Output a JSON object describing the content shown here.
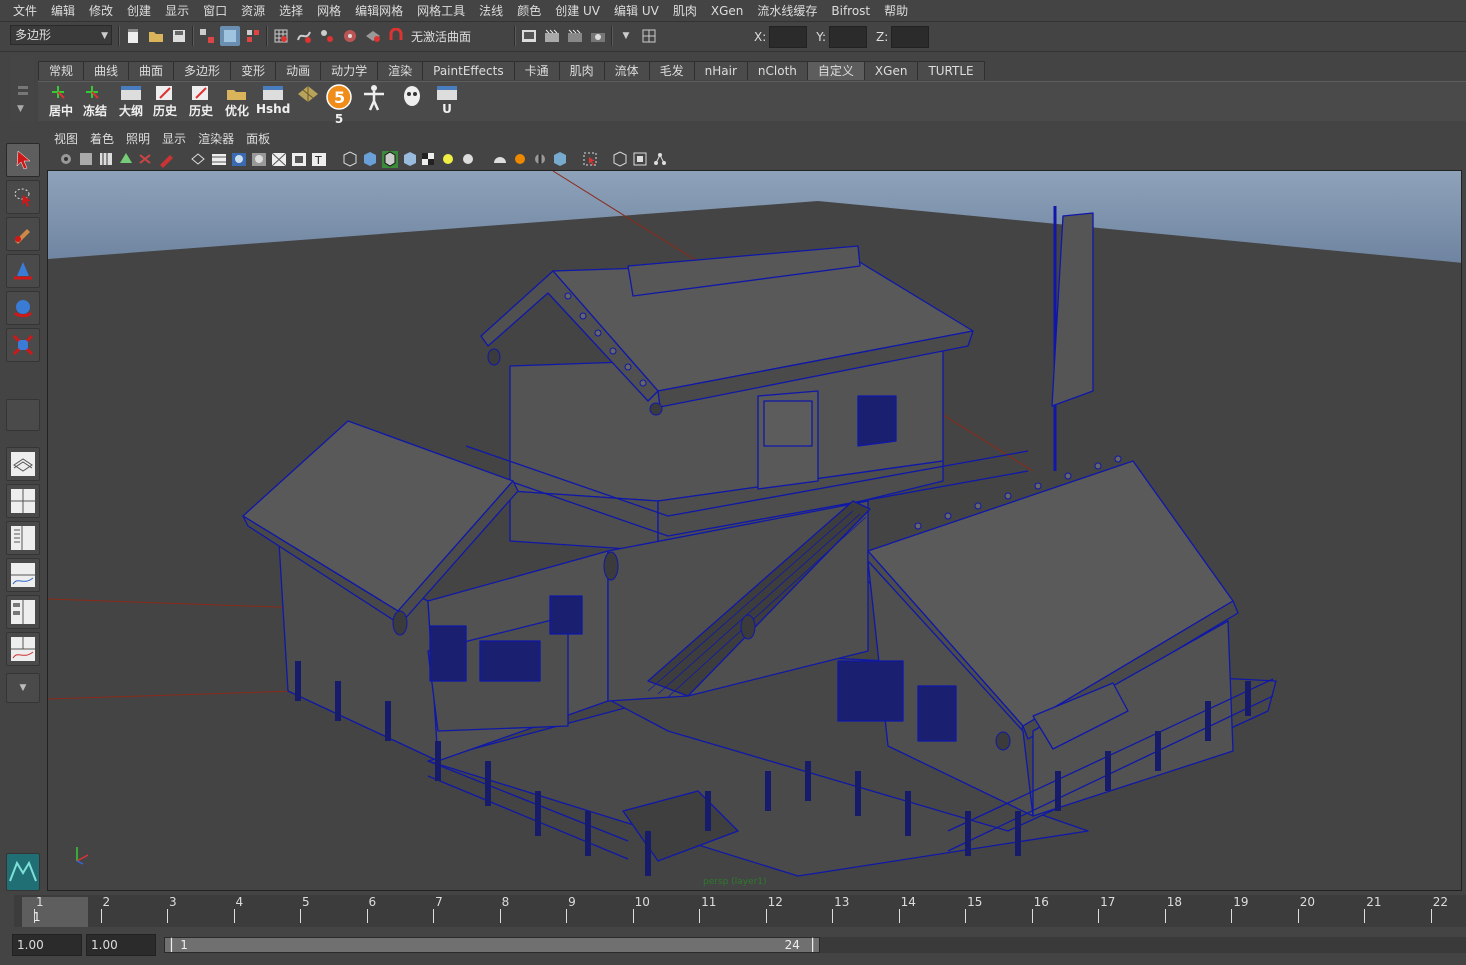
{
  "menubar": [
    "文件",
    "编辑",
    "修改",
    "创建",
    "显示",
    "窗口",
    "资源",
    "选择",
    "网格",
    "编辑网格",
    "网格工具",
    "法线",
    "颜色",
    "创建 UV",
    "编辑 UV",
    "肌肉",
    "XGen",
    "流水线缓存",
    "Bifrost",
    "帮助"
  ],
  "statusline": {
    "mode": "多边形",
    "live_surface": "无激活曲面",
    "x_label": "X:",
    "y_label": "Y:",
    "z_label": "Z:"
  },
  "shelf": {
    "tabs": [
      "常规",
      "曲线",
      "曲面",
      "多边形",
      "变形",
      "动画",
      "动力学",
      "渲染",
      "PaintEffects",
      "卡通",
      "肌肉",
      "流体",
      "毛发",
      "nHair",
      "nCloth",
      "自定义",
      "XGen",
      "TURTLE"
    ],
    "active_tab": "自定义",
    "buttons": [
      "居中",
      "冻结",
      "大纲",
      "历史",
      "历史",
      "优化",
      "Hshd",
      "",
      "5",
      "",
      "",
      "U"
    ]
  },
  "panel": {
    "menus": [
      "视图",
      "着色",
      "照明",
      "显示",
      "渲染器",
      "面板"
    ],
    "camera_label": "persp (layer1)"
  },
  "timeline": {
    "ticks": [
      "1",
      "2",
      "3",
      "4",
      "5",
      "6",
      "7",
      "8",
      "9",
      "10",
      "11",
      "12",
      "13",
      "14",
      "15",
      "16",
      "17",
      "18",
      "19",
      "20",
      "21",
      "22"
    ],
    "current_frame": "1"
  },
  "range": {
    "start_time": "1.00",
    "playback_start": "1.00",
    "slider_start": "1",
    "slider_end": "24"
  },
  "colors": {
    "wire": "#0f18a8",
    "sky": "#7a8fa8",
    "ground": "#444444",
    "ui_bg": "#444444"
  }
}
